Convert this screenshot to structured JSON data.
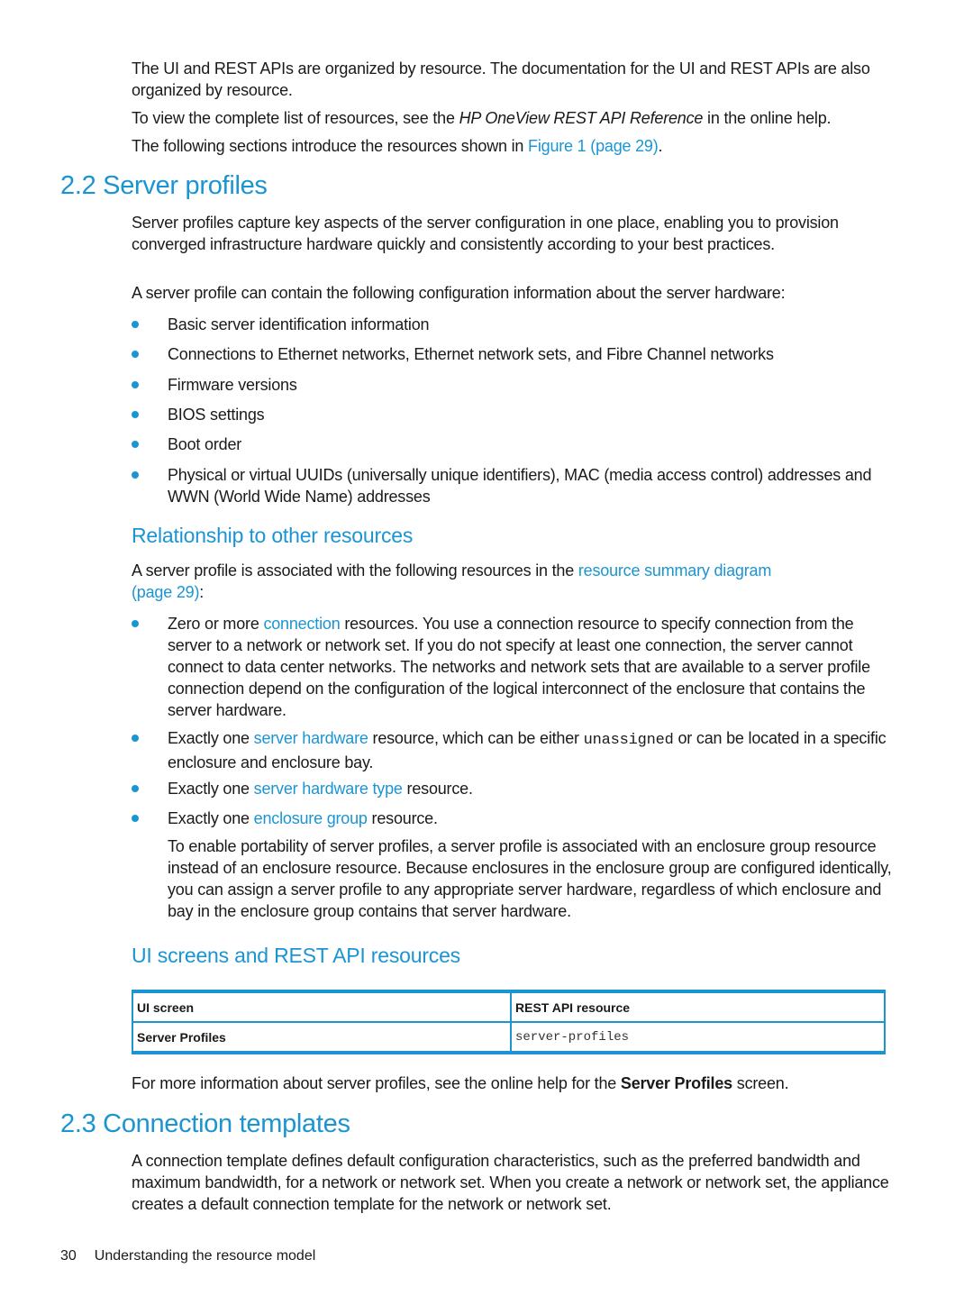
{
  "intro": {
    "para1": "The UI and REST APIs are organized by resource. The documentation for the UI and REST APIs are also organized by resource.",
    "para2_before": "To view the complete list of resources, see the ",
    "para2_italic": "HP OneView REST API Reference",
    "para2_after": " in the online help.",
    "para3_before": "The following sections introduce the resources shown in ",
    "para3_link": "Figure 1 (page 29)",
    "para3_after": "."
  },
  "section_2_2": {
    "title": "2.2 Server profiles",
    "para1": "Server profiles capture key aspects of the server configuration in one place, enabling you to provision converged infrastructure hardware quickly and consistently according to your best practices.",
    "para2": "A server profile can contain the following configuration information about the server hardware:",
    "bullets": [
      "Basic server identification information",
      "Connections to Ethernet networks, Ethernet network sets, and Fibre Channel networks",
      "Firmware versions",
      "BIOS settings",
      "Boot order",
      "Physical or virtual UUIDs (universally unique identifiers), MAC (media access control) addresses and WWN (World Wide Name) addresses"
    ],
    "relationship": {
      "title": "Relationship to other resources",
      "intro_before": "A server profile is associated with the following resources in the ",
      "intro_link": "resource summary diagram (page 29)",
      "intro_after": ":",
      "items": [
        {
          "before": "Zero or more ",
          "link": "connection",
          "after": " resources. You use a connection resource to specify connection from the server to a network or network set. If you do not specify at least one connection, the server cannot connect to data center networks. The networks and network sets that are available to a server profile connection depend on the configuration of the logical interconnect of the enclosure that contains the server hardware."
        },
        {
          "before": "Exactly one ",
          "link": "server hardware",
          "middle": " resource, which can be either ",
          "code": "unassigned",
          "after": " or can be located in a specific enclosure and enclosure bay."
        },
        {
          "before": "Exactly one ",
          "link": "server hardware type",
          "after": " resource."
        },
        {
          "before": "Exactly one ",
          "link": "enclosure group",
          "after": " resource."
        }
      ],
      "portability_note": "To enable portability of server profiles, a server profile is associated with an enclosure group resource instead of an enclosure resource. Because enclosures in the enclosure group are configured identically, you can assign a server profile to any appropriate server hardware, regardless of which enclosure and bay in the enclosure group contains that server hardware."
    },
    "ui_screens": {
      "title": "UI screens and REST API resources",
      "table": {
        "headers": [
          "UI screen",
          "REST API resource"
        ],
        "rows": [
          [
            "Server Profiles",
            "server-profiles"
          ]
        ]
      },
      "more_info_before": "For more information about server profiles, see the online help for the ",
      "more_info_bold": "Server Profiles",
      "more_info_after": " screen."
    }
  },
  "section_2_3": {
    "title": "2.3 Connection templates",
    "para1": "A connection template defines default configuration characteristics, such as the preferred bandwidth and maximum bandwidth, for a network or network set. When you create a network or network set, the appliance creates a default connection template for the network or network set."
  },
  "footer": {
    "page_number": "30",
    "chapter_title": "Understanding the resource model"
  },
  "colors": {
    "accent": "#1b95d2",
    "text": "#1a1a1a"
  }
}
